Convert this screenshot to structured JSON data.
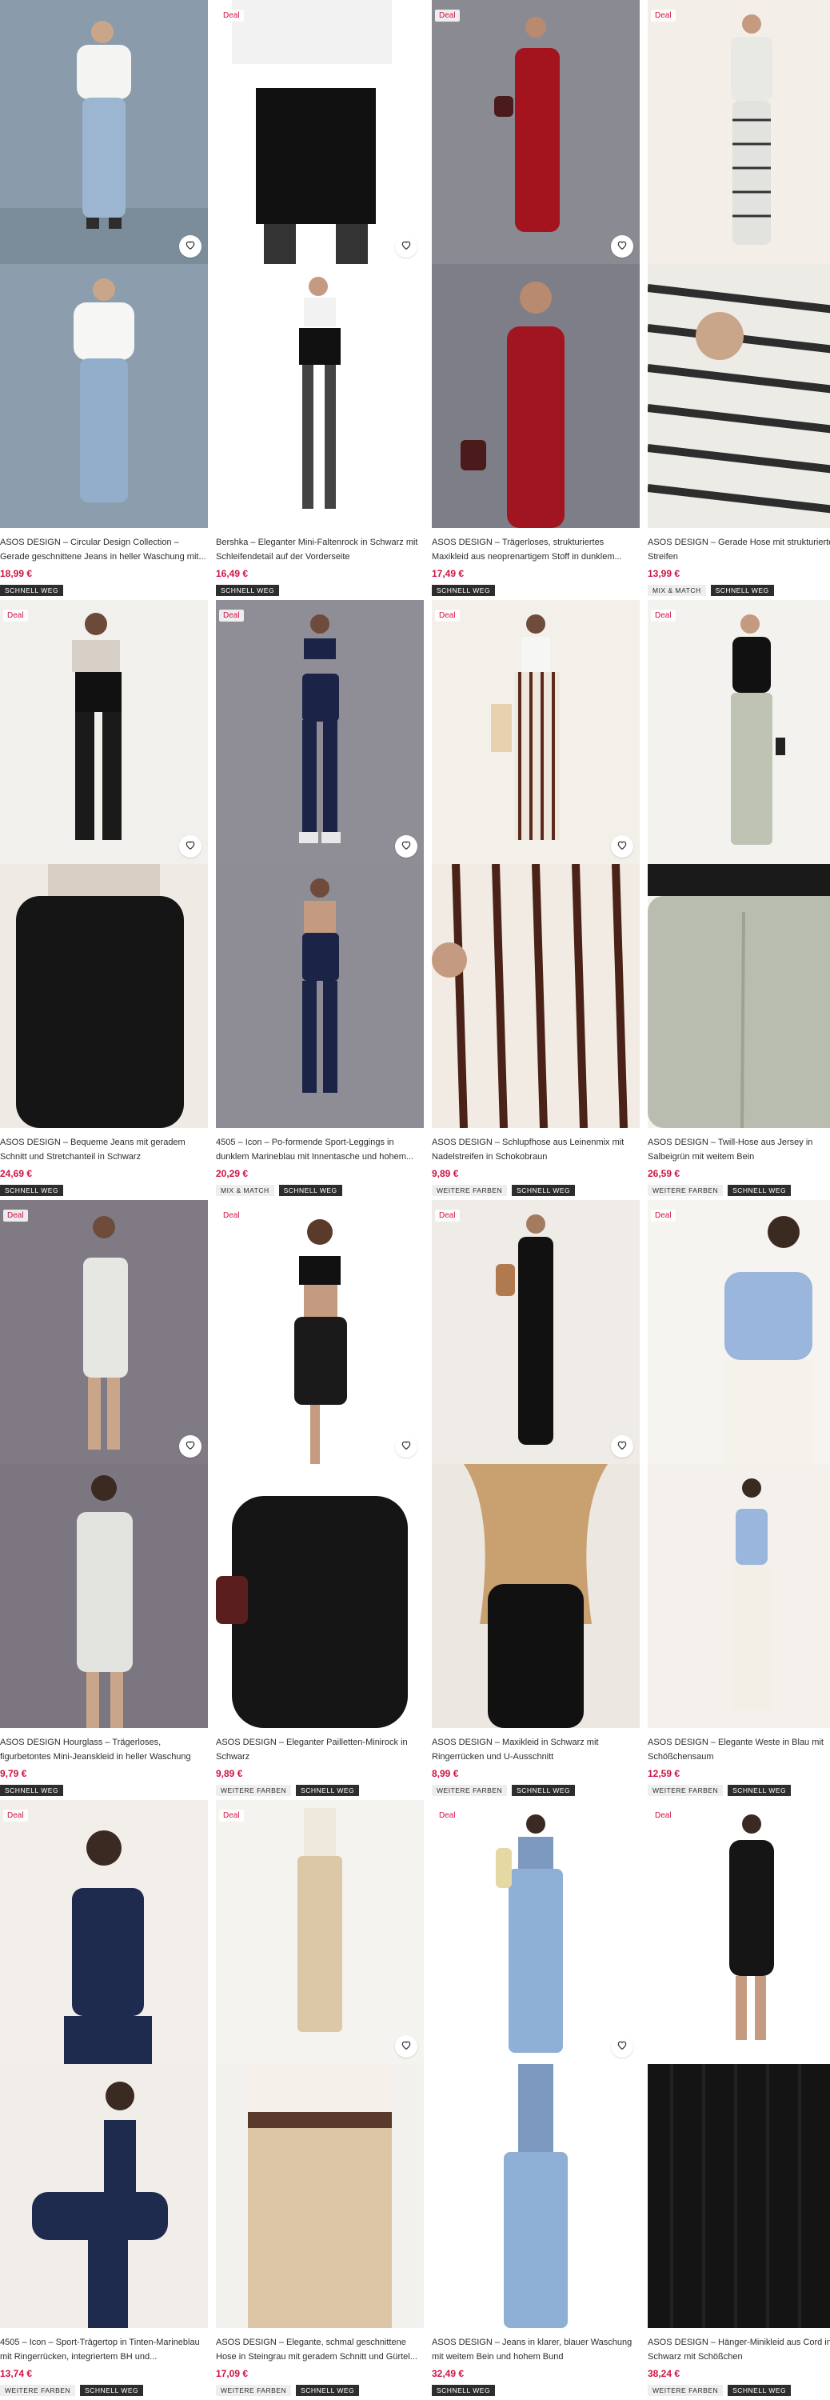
{
  "colors": {
    "price": "#d01345",
    "deal": "#d01345",
    "badge_dark": "#2d2d2d",
    "badge_light": "#eeeeee"
  },
  "labels": {
    "deal": "Deal",
    "wishlist_icon": "heart-icon"
  },
  "products": [
    {
      "title": "ASOS DESIGN – Circular Design Collection – Gerade geschnittene Jeans in heller Waschung mit...",
      "price": "18,99 €",
      "deal": false,
      "badges": [
        "SCHNELL WEG"
      ]
    },
    {
      "title": "Bershka – Eleganter Mini-Faltenrock in Schwarz mit Schleifendetail auf der Vorderseite",
      "price": "16,49 €",
      "deal": true,
      "badges": [
        "SCHNELL WEG"
      ]
    },
    {
      "title": "ASOS DESIGN – Trägerloses, strukturiertes Maxikleid aus neoprenartigem Stoff in dunklem...",
      "price": "17,49 €",
      "deal": true,
      "badges": [
        "SCHNELL WEG"
      ]
    },
    {
      "title": "ASOS DESIGN – Gerade Hose mit strukturierten Streifen",
      "price": "13,99 €",
      "deal": true,
      "badges": [
        "MIX & MATCH",
        "SCHNELL WEG"
      ]
    },
    {
      "title": "ASOS DESIGN – Bequeme Jeans mit geradem Schnitt und Stretchanteil in Schwarz",
      "price": "24,69 €",
      "deal": true,
      "badges": [
        "SCHNELL WEG"
      ]
    },
    {
      "title": "4505 – Icon – Po-formende Sport-Leggings in dunklem Marineblau mit Innentasche und hohem...",
      "price": "20,29 €",
      "deal": true,
      "badges": [
        "MIX & MATCH",
        "SCHNELL WEG"
      ]
    },
    {
      "title": "ASOS DESIGN – Schlupfhose aus Leinenmix mit Nadelstreifen in Schokobraun",
      "price": "9,89 €",
      "deal": true,
      "badges": [
        "WEITERE FARBEN",
        "SCHNELL WEG"
      ]
    },
    {
      "title": "ASOS DESIGN – Twill-Hose aus Jersey in Salbeigrün mit weitem Bein",
      "price": "26,59 €",
      "deal": true,
      "badges": [
        "WEITERE FARBEN",
        "SCHNELL WEG"
      ]
    },
    {
      "title": "ASOS DESIGN Hourglass – Trägerloses, figurbetontes Mini-Jeanskleid in heller Waschung",
      "price": "9,79 €",
      "deal": true,
      "badges": [
        "SCHNELL WEG"
      ]
    },
    {
      "title": "ASOS DESIGN – Eleganter Pailletten-Minirock in Schwarz",
      "price": "9,89 €",
      "deal": true,
      "badges": [
        "WEITERE FARBEN",
        "SCHNELL WEG"
      ]
    },
    {
      "title": "ASOS DESIGN – Maxikleid in Schwarz mit Ringerrücken und U-Ausschnitt",
      "price": "8,99 €",
      "deal": true,
      "badges": [
        "WEITERE FARBEN",
        "SCHNELL WEG"
      ]
    },
    {
      "title": "ASOS DESIGN – Elegante Weste in Blau mit Schößchensaum",
      "price": "12,59 €",
      "deal": true,
      "badges": [
        "WEITERE FARBEN",
        "SCHNELL WEG"
      ]
    },
    {
      "title": "4505 – Icon – Sport-Trägertop in Tinten-Marineblau mit Ringerrücken, integriertem BH und...",
      "price": "13,74 €",
      "deal": true,
      "badges": [
        "WEITERE FARBEN",
        "SCHNELL WEG"
      ]
    },
    {
      "title": "ASOS DESIGN – Elegante, schmal geschnittene Hose in Steingrau mit geradem Schnitt und Gürtel...",
      "price": "17,09 €",
      "deal": true,
      "badges": [
        "WEITERE FARBEN",
        "SCHNELL WEG"
      ]
    },
    {
      "title": "ASOS DESIGN – Jeans in klarer, blauer Waschung mit weitem Bein und hohem Bund",
      "price": "32,49 €",
      "deal": true,
      "badges": [
        "SCHNELL WEG"
      ]
    },
    {
      "title": "ASOS DESIGN – Hänger-Minikleid aus Cord in Schwarz mit Schößchen",
      "price": "38,24 €",
      "deal": true,
      "badges": [
        "WEITERE FARBEN",
        "SCHNELL WEG"
      ]
    }
  ]
}
